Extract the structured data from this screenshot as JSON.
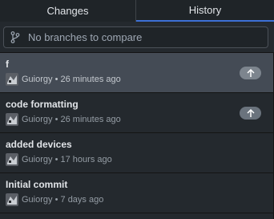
{
  "tabs": {
    "changes": "Changes",
    "history": "History"
  },
  "filter": {
    "placeholder": "No branches to compare",
    "icon": "git-branch-icon"
  },
  "commits": [
    {
      "title": "f",
      "author": "Guiorgy",
      "separator": "•",
      "time": "26 minutes ago",
      "unpushed": true,
      "selected": true
    },
    {
      "title": "code formatting",
      "author": "Guiorgy",
      "separator": "•",
      "time": "26 minutes ago",
      "unpushed": true,
      "selected": false
    },
    {
      "title": "added devices",
      "author": "Guiorgy",
      "separator": "•",
      "time": "17 hours ago",
      "unpushed": false,
      "selected": false
    },
    {
      "title": "Initial commit",
      "author": "Guiorgy",
      "separator": "•",
      "time": "7 days ago",
      "unpushed": false,
      "selected": false
    }
  ],
  "colors": {
    "accent": "#3d70d6",
    "background": "#24292e",
    "selected_row": "#444b55",
    "badge": "#6a737d"
  }
}
